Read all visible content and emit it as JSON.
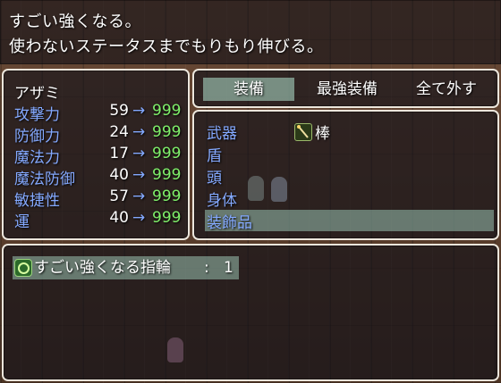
{
  "help": {
    "line1": "すごい強くなる。",
    "line2": "使わないステータスまでもりもり伸びる。"
  },
  "status": {
    "actor_name": "アザミ",
    "stats": [
      {
        "label": "攻撃力",
        "old": "59",
        "arrow": "→",
        "new": "999"
      },
      {
        "label": "防御力",
        "old": "24",
        "arrow": "→",
        "new": "999"
      },
      {
        "label": "魔法力",
        "old": "17",
        "arrow": "→",
        "new": "999"
      },
      {
        "label": "魔法防御",
        "old": "40",
        "arrow": "→",
        "new": "999"
      },
      {
        "label": "敏捷性",
        "old": "57",
        "arrow": "→",
        "new": "999"
      },
      {
        "label": "運",
        "old": "40",
        "arrow": "→",
        "new": "999"
      }
    ]
  },
  "command": {
    "items": [
      "装備",
      "最強装備",
      "全て外す"
    ],
    "selected_index": 0
  },
  "slots": [
    {
      "label": "武器",
      "item": "棒",
      "icon": "staff-icon"
    },
    {
      "label": "盾",
      "item": ""
    },
    {
      "label": "頭",
      "item": ""
    },
    {
      "label": "身体",
      "item": ""
    },
    {
      "label": "装飾品",
      "item": ""
    }
  ],
  "selected_slot": 4,
  "item_list": [
    {
      "name": "すごい強くなる指輪",
      "colon": ":",
      "count": "1",
      "icon": "ring-icon"
    }
  ],
  "colors": {
    "system_blue": "#84a9ff",
    "power_up_green": "#7ff06a",
    "window_border": "#ece6dc"
  }
}
